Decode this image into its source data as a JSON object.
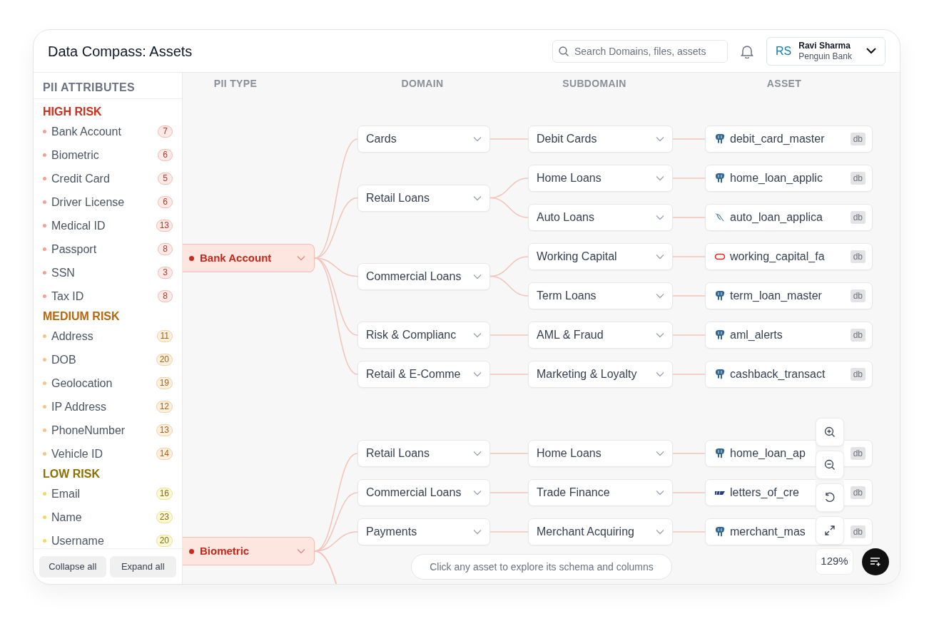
{
  "window": {
    "title": "Data Compass: Assets"
  },
  "search": {
    "placeholder": "Search Domains, files, assets"
  },
  "user": {
    "initials": "RS",
    "name": "Ravi Sharma",
    "org": "Penguin Bank"
  },
  "sidebar": {
    "title": "PII ATTRIBUTES",
    "groups": [
      {
        "title": "HIGH RISK",
        "kind": "high",
        "items": [
          {
            "label": "Bank Account",
            "count": "7"
          },
          {
            "label": "Biometric",
            "count": "6"
          },
          {
            "label": "Credit Card",
            "count": "5"
          },
          {
            "label": "Driver License",
            "count": "6"
          },
          {
            "label": "Medical ID",
            "count": "13"
          },
          {
            "label": "Passport",
            "count": "8"
          },
          {
            "label": "SSN",
            "count": "3"
          },
          {
            "label": "Tax ID",
            "count": "8"
          }
        ]
      },
      {
        "title": "MEDIUM RISK",
        "kind": "medium",
        "items": [
          {
            "label": "Address",
            "count": "11"
          },
          {
            "label": "DOB",
            "count": "20"
          },
          {
            "label": "Geolocation",
            "count": "19"
          },
          {
            "label": "IP Address",
            "count": "12"
          },
          {
            "label": "PhoneNumber",
            "count": "13"
          },
          {
            "label": "Vehicle ID",
            "count": "14"
          }
        ]
      },
      {
        "title": "LOW RISK",
        "kind": "low",
        "items": [
          {
            "label": "Email",
            "count": "16"
          },
          {
            "label": "Name",
            "count": "23"
          },
          {
            "label": "Username",
            "count": "20"
          }
        ]
      }
    ],
    "buttons": [
      "Collapse all",
      "Expand all"
    ]
  },
  "columns": [
    "PII TYPE",
    "DOMAIN",
    "SUBDOMAIN",
    "ASSET"
  ],
  "tree": [
    {
      "label": "Bank Account",
      "domains": [
        {
          "label": "Cards",
          "subdomains": [
            {
              "label": "Debit Cards",
              "asset": {
                "name": "debit_card_master",
                "kind": "postgres",
                "tag": "db"
              }
            }
          ]
        },
        {
          "label": "Retail Loans",
          "subdomains": [
            {
              "label": "Home Loans",
              "asset": {
                "name": "home_loan_applic",
                "kind": "postgres",
                "tag": "db"
              }
            },
            {
              "label": "Auto Loans",
              "asset": {
                "name": "auto_loan_applica",
                "kind": "mysql",
                "tag": "db"
              }
            }
          ]
        },
        {
          "label": "Commercial Loans",
          "subdomains": [
            {
              "label": "Working Capital",
              "asset": {
                "name": "working_capital_fa",
                "kind": "oracle",
                "tag": "db"
              }
            },
            {
              "label": "Term Loans",
              "asset": {
                "name": "term_loan_master",
                "kind": "postgres",
                "tag": "db"
              }
            }
          ]
        },
        {
          "label": "Risk & Complianc",
          "subdomains": [
            {
              "label": "AML & Fraud",
              "asset": {
                "name": "aml_alerts",
                "kind": "postgres",
                "tag": "db"
              }
            }
          ]
        },
        {
          "label": "Retail & E-Comme",
          "subdomains": [
            {
              "label": "Marketing & Loyalty",
              "asset": {
                "name": "cashback_transact",
                "kind": "postgres",
                "tag": "db"
              }
            }
          ]
        }
      ]
    },
    {
      "label": "Biometric",
      "domains": [
        {
          "label": "Retail Loans",
          "subdomains": [
            {
              "label": "Home Loans",
              "asset": {
                "name": "home_loan_ap",
                "kind": "postgres",
                "tag": "db"
              }
            }
          ]
        },
        {
          "label": "Commercial Loans",
          "subdomains": [
            {
              "label": "Trade Finance",
              "asset": {
                "name": "letters_of_cre",
                "kind": "flag",
                "tag": "db"
              }
            }
          ]
        },
        {
          "label": "Payments",
          "subdomains": [
            {
              "label": "Merchant Acquiring",
              "asset": {
                "name": "merchant_mas",
                "kind": "postgres",
                "tag": "db"
              }
            }
          ]
        }
      ]
    }
  ],
  "zoom": {
    "level_text": "129%"
  },
  "hint": "Click any asset to explore its schema and columns"
}
